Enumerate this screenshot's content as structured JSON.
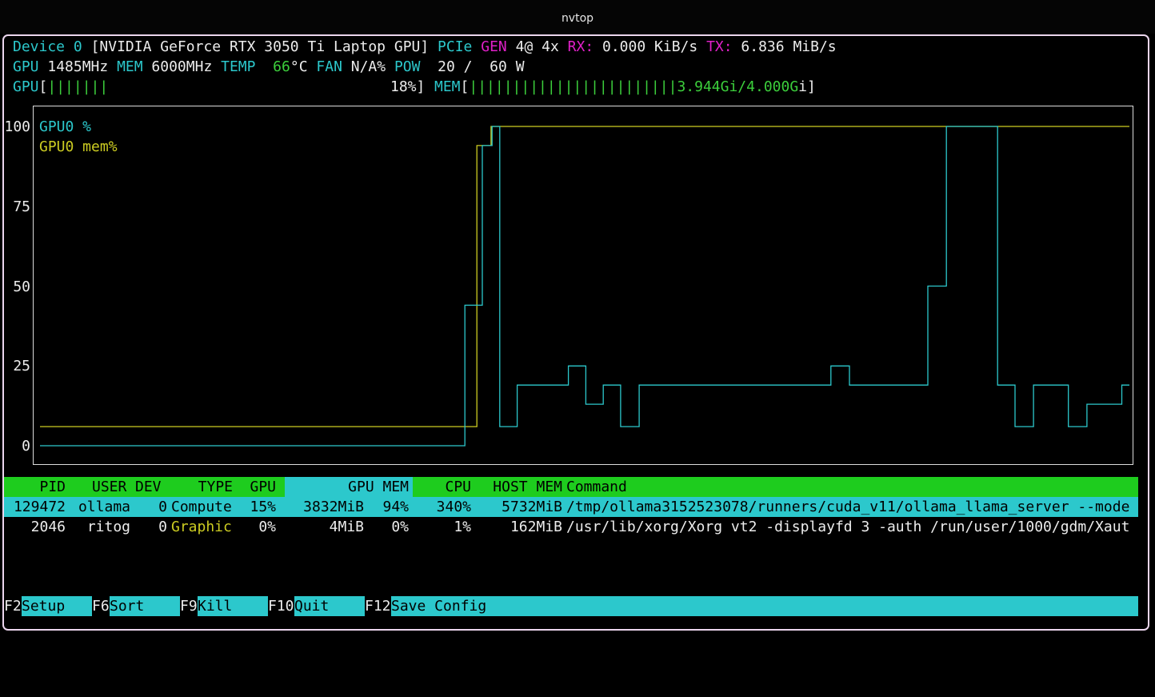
{
  "window": {
    "title": "nvtop"
  },
  "device": {
    "label": "Device",
    "index": "0",
    "name": "[NVIDIA GeForce RTX 3050 Ti Laptop GPU]",
    "pcie_label": "PCIe",
    "gen_label": "GEN",
    "gen_value": "4@ 4x",
    "rx_label": "RX:",
    "rx_value": "0.000 KiB/s",
    "tx_label": "TX:",
    "tx_value": "6.836 MiB/s"
  },
  "stats": {
    "gpu_label": "GPU",
    "gpu_clock": "1485MHz",
    "mem_label": "MEM",
    "mem_clock": "6000MHz",
    "temp_label": "TEMP",
    "temp_value": "66",
    "temp_unit": "°C",
    "fan_label": "FAN",
    "fan_value": "N/A%",
    "pow_label": "POW",
    "pow_value": "20 /  60 W"
  },
  "bars": {
    "gpu_label": "GPU",
    "gpu_open": "[",
    "gpu_fill": "|||||||",
    "gpu_percent": "18%]",
    "gpu_fraction": 0.18,
    "mem_label": "MEM",
    "mem_open": "[",
    "mem_fill": "||||||||||||||||||||||||3.944G",
    "mem_tail": "i/4.000G",
    "mem_tail2": "i]",
    "mem_fraction": 0.986
  },
  "chart_data": {
    "type": "line",
    "ylim": [
      0,
      100
    ],
    "yticks": [
      "100",
      "75",
      "50",
      "25",
      "0"
    ],
    "xlim": [
      0,
      100
    ],
    "legend": [
      "GPU0 %",
      "GPU0 mem%"
    ],
    "colors": {
      "gpu": "#2cc8cc",
      "mem": "#cccc22"
    },
    "series": [
      {
        "name": "GPU0 %",
        "points": [
          [
            0,
            0
          ],
          [
            39,
            0
          ],
          [
            39,
            44
          ],
          [
            40.6,
            44
          ],
          [
            40.6,
            94
          ],
          [
            41.5,
            94
          ],
          [
            41.5,
            100
          ],
          [
            42.2,
            100
          ],
          [
            42.2,
            6
          ],
          [
            43.8,
            6
          ],
          [
            43.8,
            19
          ],
          [
            48.5,
            19
          ],
          [
            48.5,
            25
          ],
          [
            50.1,
            25
          ],
          [
            50.1,
            13
          ],
          [
            51.7,
            13
          ],
          [
            51.7,
            19
          ],
          [
            53.3,
            19
          ],
          [
            53.3,
            6
          ],
          [
            55,
            6
          ],
          [
            55,
            19
          ],
          [
            72.6,
            19
          ],
          [
            72.6,
            25
          ],
          [
            74.3,
            25
          ],
          [
            74.3,
            19
          ],
          [
            81.5,
            19
          ],
          [
            81.5,
            50
          ],
          [
            83.2,
            50
          ],
          [
            83.2,
            100
          ],
          [
            87.9,
            100
          ],
          [
            87.9,
            19
          ],
          [
            89.5,
            19
          ],
          [
            89.5,
            6
          ],
          [
            91.2,
            6
          ],
          [
            91.2,
            19
          ],
          [
            94.4,
            19
          ],
          [
            94.4,
            6
          ],
          [
            96.1,
            6
          ],
          [
            96.1,
            13
          ],
          [
            99.3,
            13
          ],
          [
            99.3,
            19
          ],
          [
            100,
            19
          ]
        ]
      },
      {
        "name": "GPU0 mem%",
        "points": [
          [
            0,
            6
          ],
          [
            40.1,
            6
          ],
          [
            40.1,
            94
          ],
          [
            41.4,
            94
          ],
          [
            41.4,
            100
          ],
          [
            100,
            100
          ]
        ]
      }
    ]
  },
  "table": {
    "headers": {
      "pid": "PID",
      "user": "USER",
      "dev": "DEV",
      "type": "TYPE",
      "gpu": "GPU",
      "gpu_mem": "GPU MEM",
      "cpu": "CPU",
      "host_mem": "HOST MEM",
      "command": "Command"
    },
    "rows": [
      {
        "pid": "129472",
        "user": "ollama",
        "dev": "0",
        "type": "Compute",
        "gpu": "15%",
        "gpu_mem": "3832MiB",
        "gpu_mem_pct": "94%",
        "cpu": "340%",
        "host_mem": "5732MiB",
        "command": "/tmp/ollama3152523078/runners/cuda_v11/ollama_llama_server --mode"
      },
      {
        "pid": "2046",
        "user": "ritog",
        "dev": "0",
        "type": "Graphic",
        "gpu": "0%",
        "gpu_mem": "4MiB",
        "gpu_mem_pct": "0%",
        "cpu": "1%",
        "host_mem": "162MiB",
        "command": "/usr/lib/xorg/Xorg vt2 -displayfd 3 -auth /run/user/1000/gdm/Xaut"
      }
    ]
  },
  "footer": [
    {
      "key": "F2",
      "label": "Setup"
    },
    {
      "key": "F6",
      "label": "Sort"
    },
    {
      "key": "F9",
      "label": "Kill"
    },
    {
      "key": "F10",
      "label": "Quit"
    },
    {
      "key": "F12",
      "label": "Save Config"
    }
  ]
}
